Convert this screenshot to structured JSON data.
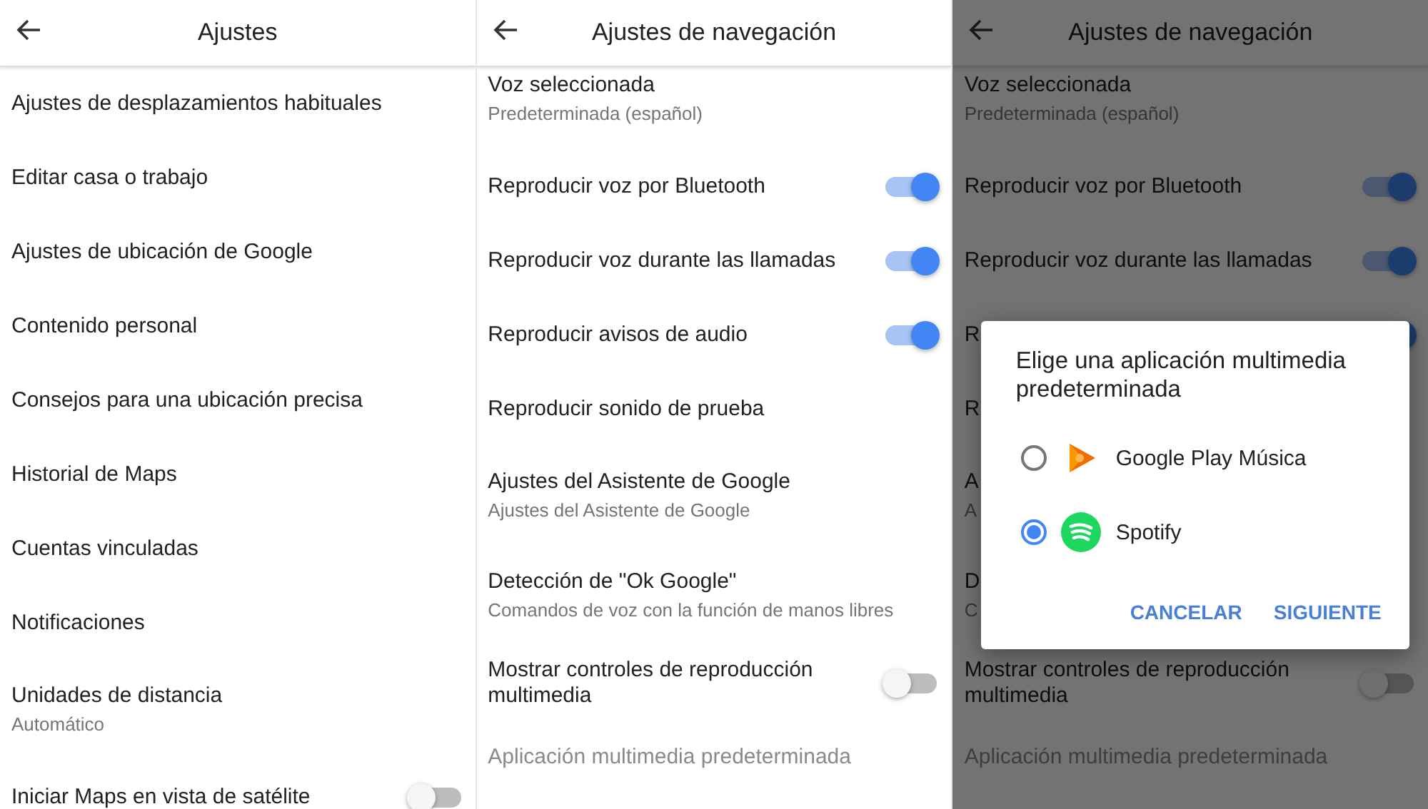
{
  "screens": [
    {
      "title": "Ajustes",
      "scrolled": false,
      "items": [
        {
          "label": "Ajustes de desplazamientos habituales",
          "kind": "plain",
          "disabled": false
        },
        {
          "label": "Editar casa o trabajo",
          "kind": "plain",
          "disabled": false
        },
        {
          "label": "Ajustes de ubicación de Google",
          "kind": "plain",
          "disabled": false
        },
        {
          "label": "Contenido personal",
          "kind": "plain",
          "disabled": false
        },
        {
          "label": "Consejos para una ubicación precisa",
          "kind": "plain",
          "disabled": false
        },
        {
          "label": "Historial de Maps",
          "kind": "plain",
          "disabled": false
        },
        {
          "label": "Cuentas vinculadas",
          "kind": "plain",
          "disabled": false
        },
        {
          "label": "Notificaciones",
          "kind": "plain",
          "disabled": false
        },
        {
          "label": "Unidades de distancia",
          "sub": "Automático",
          "kind": "plain",
          "disabled": false
        },
        {
          "label": "Iniciar Maps en vista de satélite",
          "kind": "toggle",
          "on": false,
          "disabled": false
        }
      ]
    },
    {
      "title": "Ajustes de navegación",
      "scrolled": true,
      "items": [
        {
          "label": "Voz seleccionada",
          "sub": "Predeterminada (español)",
          "kind": "plain",
          "disabled": false
        },
        {
          "label": "Reproducir voz por Bluetooth",
          "kind": "toggle",
          "on": true,
          "disabled": false
        },
        {
          "label": "Reproducir voz durante las llamadas",
          "kind": "toggle",
          "on": true,
          "disabled": false
        },
        {
          "label": "Reproducir avisos de audio",
          "kind": "toggle",
          "on": true,
          "disabled": false
        },
        {
          "label": "Reproducir sonido de prueba",
          "kind": "plain",
          "disabled": false
        },
        {
          "label": "Ajustes del Asistente de Google",
          "sub": "Ajustes del Asistente de Google",
          "kind": "plain",
          "disabled": false
        },
        {
          "label": "Detección de \"Ok Google\"",
          "sub": "Comandos de voz con la función de manos libres",
          "kind": "plain",
          "disabled": false
        },
        {
          "label": "Mostrar controles de reproducción multimedia",
          "kind": "toggle",
          "on": false,
          "disabled": false
        },
        {
          "label": "Aplicación multimedia predeterminada",
          "kind": "plain",
          "disabled": true
        }
      ]
    },
    {
      "title": "Ajustes de navegación",
      "scrolled": true,
      "items": [
        {
          "label": "Voz seleccionada",
          "sub": "Predeterminada (español)",
          "kind": "plain",
          "disabled": false
        },
        {
          "label": "Reproducir voz por Bluetooth",
          "kind": "toggle",
          "on": true,
          "disabled": false
        },
        {
          "label": "Reproducir voz durante las llamadas",
          "kind": "toggle",
          "on": true,
          "disabled": false
        },
        {
          "label": "R",
          "kind": "toggle",
          "on": true,
          "disabled": false
        },
        {
          "label": "R",
          "kind": "plain",
          "disabled": false
        },
        {
          "label": "A",
          "sub": "A",
          "kind": "plain",
          "disabled": false
        },
        {
          "label": "D",
          "sub": "C",
          "kind": "plain",
          "disabled": false
        },
        {
          "label": "Mostrar controles de reproducción multimedia",
          "kind": "toggle",
          "on": false,
          "disabled": false
        },
        {
          "label": "Aplicación multimedia predeterminada",
          "kind": "plain",
          "disabled": true
        }
      ],
      "dialog": {
        "title": "Elige una aplicación multimedia predeterminada",
        "options": [
          {
            "label": "Google Play Música",
            "selected": false
          },
          {
            "label": "Spotify",
            "selected": true
          }
        ],
        "buttons": [
          "CANCELAR",
          "SIGUIENTE"
        ]
      }
    }
  ]
}
